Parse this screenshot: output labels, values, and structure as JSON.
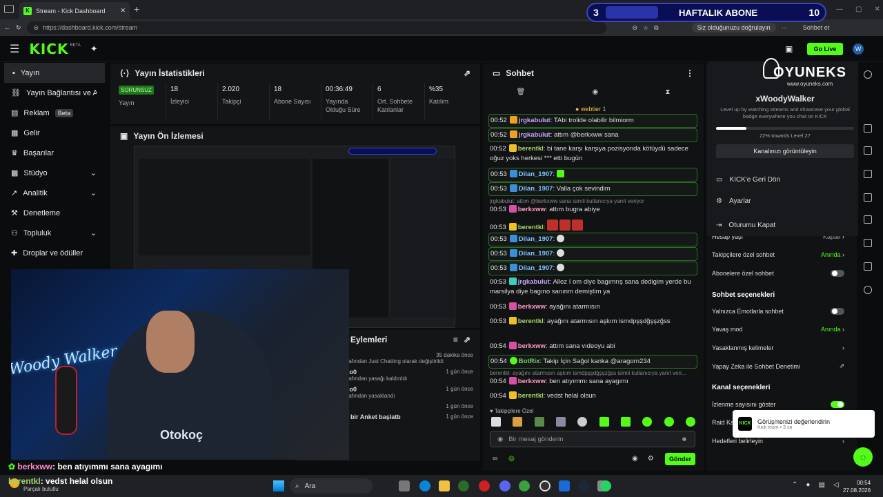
{
  "browser": {
    "tab_title": "Stream - Kick Dashboard",
    "url": "https://dashboard.kick.com/stream",
    "verify_chip": "Siz olduğunuzu doğrulayın",
    "sync_label": "Sohbet et"
  },
  "sub_goal": {
    "count": "3",
    "title": "HAFTALIK ABONE",
    "target": "10",
    "progress_pct": 30
  },
  "header": {
    "logo": "KICK",
    "beta": "BETA",
    "go_live": "Go Live"
  },
  "sidebar": {
    "items": [
      {
        "label": "Yayın",
        "icon": "camera-icon"
      },
      {
        "label": "Yayın Bağlantısı ve Anahtarı",
        "icon": "link-icon"
      },
      {
        "label": "Reklam",
        "icon": "ad-icon",
        "badge": "Beta"
      },
      {
        "label": "Gelir",
        "icon": "revenue-icon"
      },
      {
        "label": "Başarılar",
        "icon": "trophy-icon"
      },
      {
        "label": "Stüdyo",
        "icon": "studio-icon"
      },
      {
        "label": "Analitik",
        "icon": "analytics-icon"
      },
      {
        "label": "Denetleme",
        "icon": "hammer-icon"
      },
      {
        "label": "Topluluk",
        "icon": "community-icon"
      },
      {
        "label": "Droplar ve ödüller",
        "icon": "gift-icon"
      }
    ]
  },
  "stats": {
    "title": "Yayın İstatistikleri",
    "status_badge": "SORUNSUZ",
    "cells": [
      {
        "value": "",
        "label": "Yayın"
      },
      {
        "value": "18",
        "label": "İzleyici"
      },
      {
        "value": "2.020",
        "label": "Takipçi"
      },
      {
        "value": "18",
        "label": "Abone Sayısı"
      },
      {
        "value": "00:36:49",
        "label": "Yayında Olduğu Süre"
      },
      {
        "value": "6",
        "label": "Ort. Sohbete Katılanlar"
      },
      {
        "value": "%35",
        "label": "Katılım"
      }
    ]
  },
  "preview": {
    "title": "Yayın Ön İzlemesi"
  },
  "mod_actions": {
    "title": "Eylemleri",
    "rows": [
      {
        "time": "35 dakika önce",
        "user": "",
        "text": "tarafından Just Chatting olarak değiştirildi"
      },
      {
        "time": "1 gün önce",
        "user": "oko0",
        "text": "tarafından yasağı kaldırıldı"
      },
      {
        "time": "1 gün önce",
        "user": "oko0",
        "text": "tarafından yasaklandı"
      },
      {
        "time": "1 gün önce",
        "user": "",
        "text": ""
      },
      {
        "time": "1 gün önce",
        "user": "ze",
        "text": "bir Anket başlattı"
      }
    ]
  },
  "chat": {
    "title": "Sohbet",
    "top_gifter": "webtier",
    "top_gifter_count": "1",
    "messages": [
      {
        "time": "00:52",
        "user": "jrgkabulut",
        "cls": "u-jr",
        "text": "TAbi trolide olabilir bilmiorm"
      },
      {
        "time": "00:52",
        "user": "jrgkabulut",
        "cls": "u-jr",
        "text": "attım @berkxww sana"
      },
      {
        "time": "00:52",
        "user": "berentkl",
        "cls": "u-be",
        "text": "bi tane karşı karşıya pozisyonda kötüydü sadece oğuz yoks herkesi *** etti bugün"
      },
      {
        "time": "00:53",
        "user": "Dilan_1907",
        "cls": "u-di",
        "text": ""
      },
      {
        "time": "00:53",
        "user": "Dilan_1907",
        "cls": "u-di",
        "text": "Valla çok sevindim"
      },
      {
        "time": "00:53",
        "user": "berkxww",
        "cls": "u-bx",
        "text": "attım bugra abiye"
      },
      {
        "time": "00:53",
        "user": "berentkl",
        "cls": "u-be",
        "text": ""
      },
      {
        "time": "00:53",
        "user": "Dilan_1907",
        "cls": "u-di",
        "text": ""
      },
      {
        "time": "00:53",
        "user": "Dilan_1907",
        "cls": "u-di",
        "text": ""
      },
      {
        "time": "00:53",
        "user": "Dilan_1907",
        "cls": "u-di",
        "text": ""
      },
      {
        "time": "00:53",
        "user": "jrgkabulut",
        "cls": "u-jr",
        "text": "Allez I om diye bagımrış sana dedigim yerde bu marsilya diye bagıno sanınm demiştim ya"
      },
      {
        "time": "00:53",
        "user": "berkxww",
        "cls": "u-bx",
        "text": "ayağını atarmısın"
      },
      {
        "time": "00:53",
        "user": "berentkl",
        "cls": "u-be",
        "text": "ayağını atarmısın aşkım ismdpşşdğşşzğss"
      },
      {
        "time": "00:54",
        "user": "berkxww",
        "cls": "u-bx",
        "text": "attım sana vıdeoyu abi"
      },
      {
        "time": "00:54",
        "user": "BotRix",
        "cls": "u-bo",
        "text": "Takip İçin Sağol kanka @aragorn234"
      },
      {
        "time": "00:54",
        "user": "berkxww",
        "cls": "u-bx",
        "text": "ben atıyımmı sana ayagımı"
      },
      {
        "time": "00:54",
        "user": "berentkl",
        "cls": "u-be",
        "text": "vedst helal olsun"
      }
    ],
    "reply_1": "jrgkabulut: attım @berkxww sana isimli kullanıcıya yanıt veriyor",
    "reply_2": "berentkl: ayağını atarmısın aşkım ismdpşşdğşşzğss isimli kullanıcıya yanıt veri...",
    "followers_only": "Takipçilere Özel",
    "input_placeholder": "Bir mesaj gönderin",
    "send": "Gönder"
  },
  "user_menu": {
    "brand": "OYUNEKS",
    "brand_sub": "www.oyuneks.com",
    "username": "xWoodyWalker",
    "desc": "Level up by watching streams and showcase your global badge everywhere you chat on KICK",
    "level_progress": "22% towards Level 27",
    "level_pct": 22,
    "view_channel": "Kanalınızı görüntüleyin",
    "items": [
      "KICK'e Geri Dön",
      "Ayarlar",
      "Oturumu Kapat"
    ]
  },
  "settings": {
    "rows_top": [
      {
        "label": "Hesap yaşı",
        "value": "Kapalı"
      },
      {
        "label": "Takipçilere özel sohbet",
        "value": "Anında"
      },
      {
        "label": "Abonelere özel sohbet",
        "value": ""
      }
    ],
    "section_chat": "Sohbet seçenekleri",
    "rows_chat": [
      {
        "label": "Yalnızca Emotlarla sohbet",
        "value": ""
      },
      {
        "label": "Yavaş mod",
        "value": "Anında"
      },
      {
        "label": "Yasaklanmış kelimeler",
        "value": ""
      },
      {
        "label": "Yapay Zeka ile Sohbet Denetimi",
        "value": ""
      }
    ],
    "section_channel": "Kanal seçenekleri",
    "rows_channel": [
      {
        "label": "İzlenme sayısını göster",
        "value": ""
      },
      {
        "label": "Raid Ka",
        "value": ""
      },
      {
        "label": "Hedefleri belirleyin",
        "value": ""
      }
    ]
  },
  "toast": {
    "title": "Görüşmenizi değerlendirin",
    "sub": "Kick team • 3 sa"
  },
  "overlay": {
    "line1_user": "berkxww",
    "line1_text": ": ben atıyımmı sana ayagımı",
    "line2_user": "berentkl",
    "line2_text": ": vedst helal olsun",
    "weather": "Parçalı bulutlu"
  },
  "webcam": {
    "neon": "Woody Walker",
    "jersey": "Otokoç"
  },
  "taskbar": {
    "search": "Ara",
    "time": "00:54",
    "date": "27.08.2026"
  }
}
